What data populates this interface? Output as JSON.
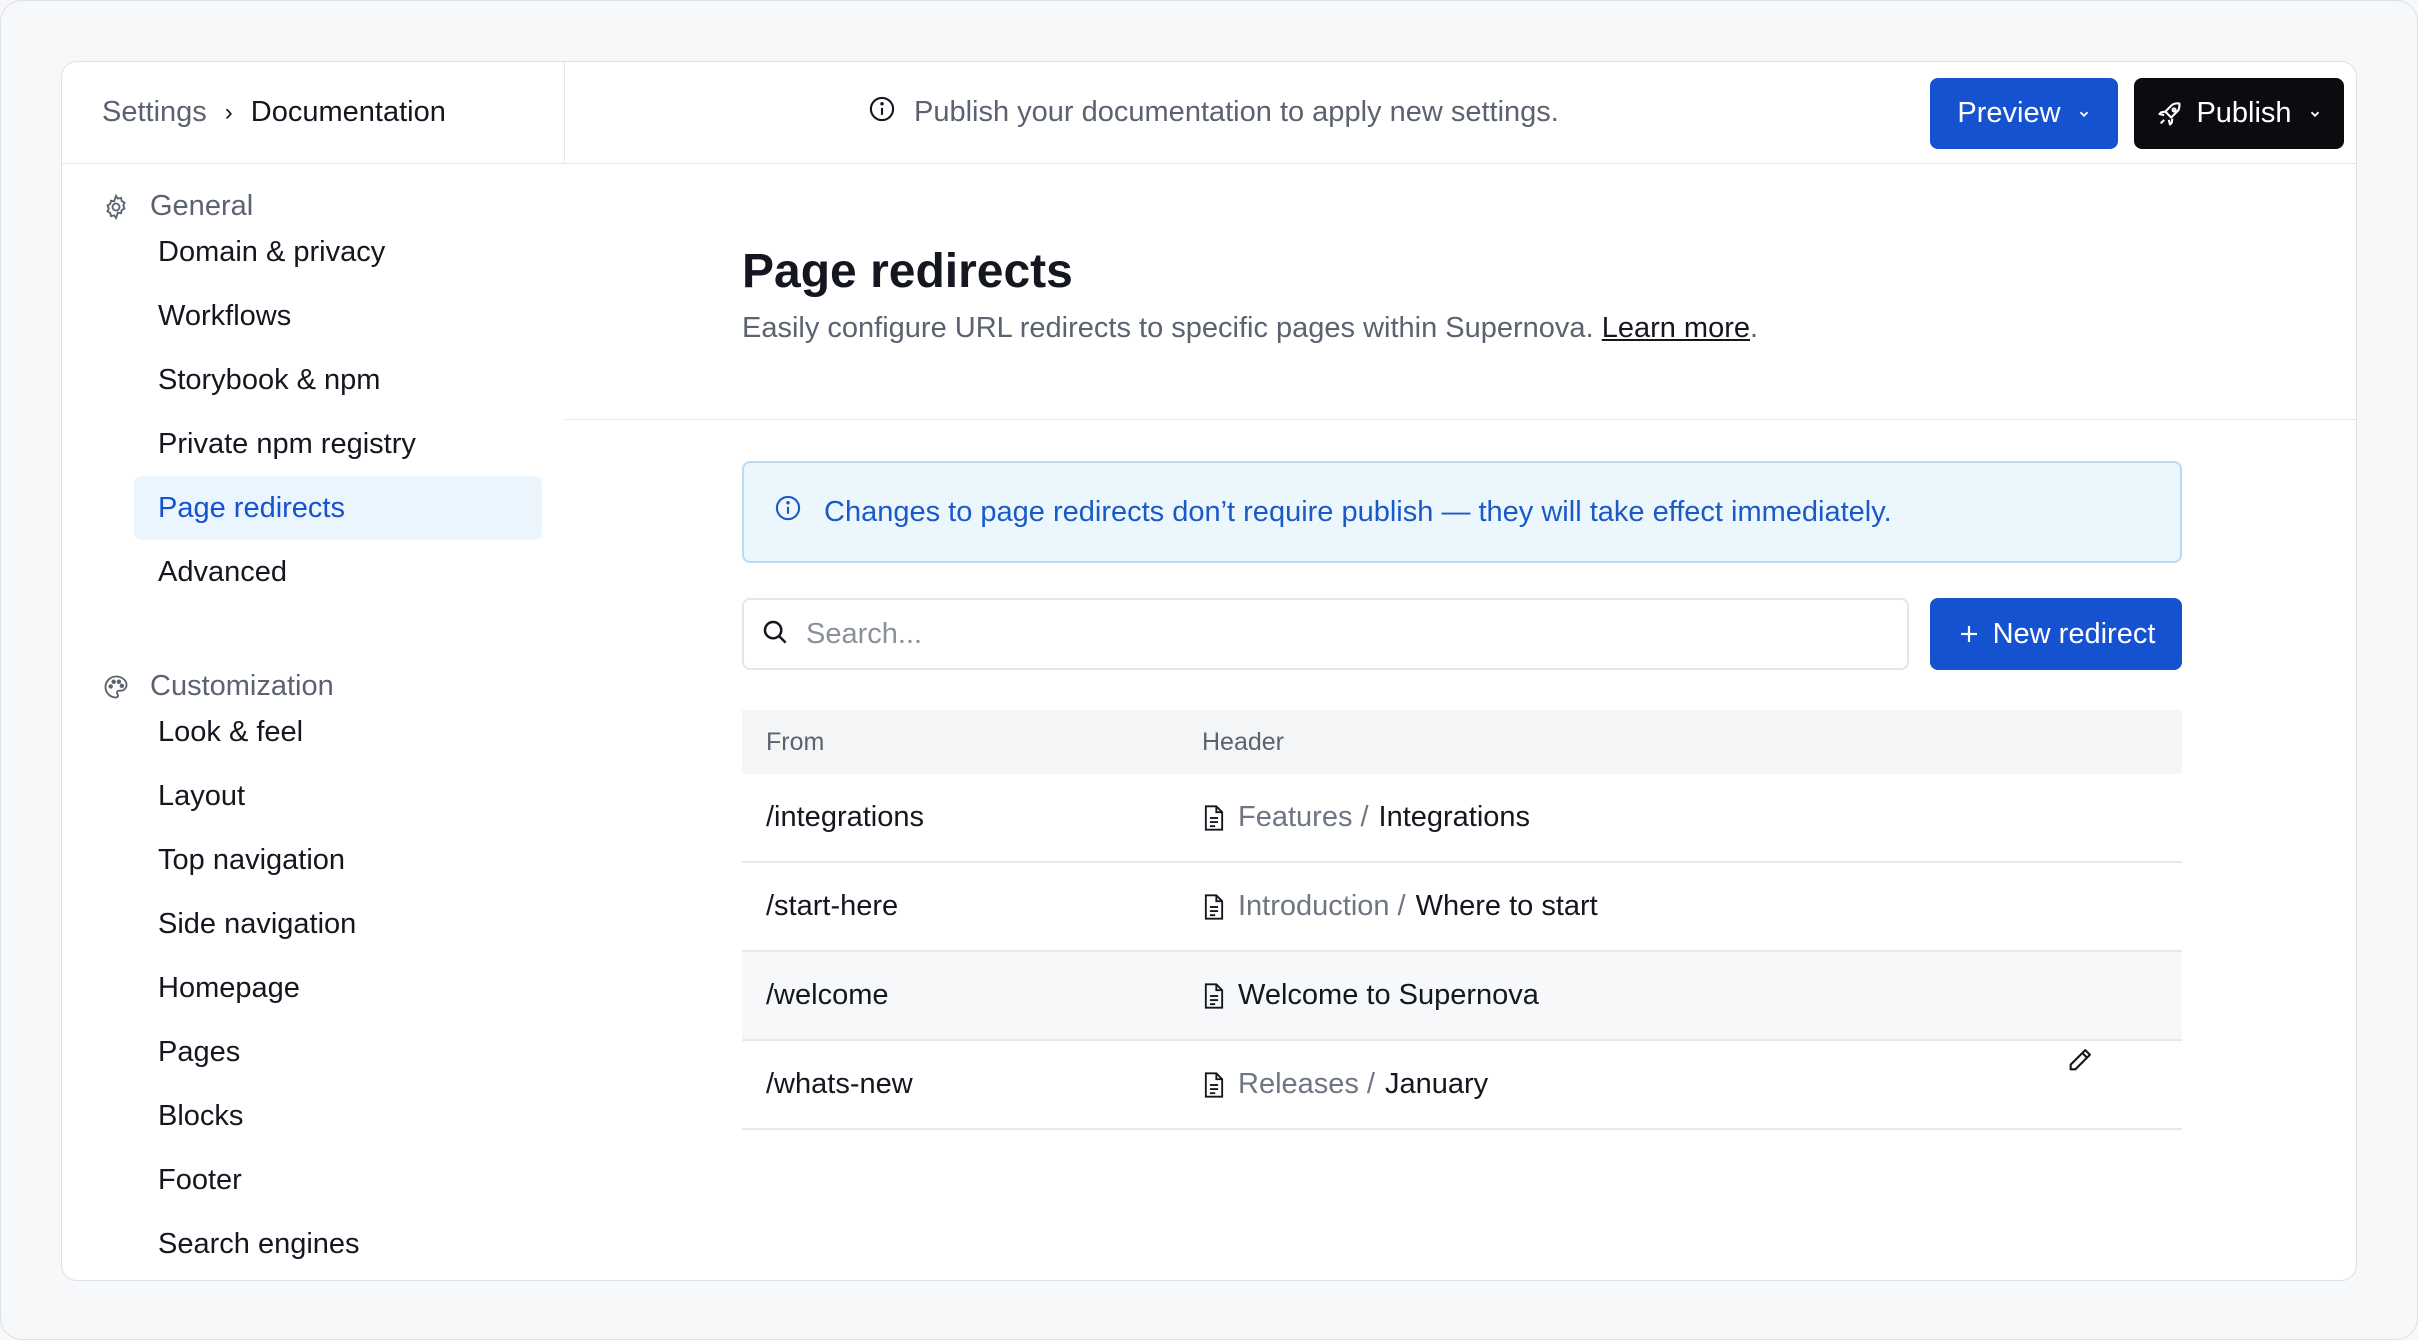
{
  "breadcrumb": {
    "root": "Settings",
    "current": "Documentation"
  },
  "topbar": {
    "notice": "Publish your documentation to apply new settings.",
    "preview_label": "Preview",
    "publish_label": "Publish"
  },
  "sidebar": {
    "groups": [
      {
        "label": "General",
        "icon": "gear-icon",
        "items": [
          "Domain & privacy",
          "Workflows",
          "Storybook & npm",
          "Private npm registry",
          "Page redirects",
          "Advanced"
        ]
      },
      {
        "label": "Customization",
        "icon": "palette-icon",
        "items": [
          "Look & feel",
          "Layout",
          "Top navigation",
          "Side navigation",
          "Homepage",
          "Pages",
          "Blocks",
          "Footer",
          "Search engines"
        ]
      }
    ],
    "active_item": "Page redirects"
  },
  "main": {
    "title": "Page redirects",
    "description": "Easily configure URL redirects to specific pages within Supernova. ",
    "learn_more": "Learn more",
    "description_end": ".",
    "banner": "Changes to page redirects don’t require publish — they will take effect immediately.",
    "search_placeholder": "Search...",
    "new_redirect_label": "New redirect",
    "table": {
      "columns": [
        "From",
        "Header"
      ],
      "rows": [
        {
          "from": "/integrations",
          "parent": "Features",
          "page": "Integrations"
        },
        {
          "from": "/start-here",
          "parent": "Introduction",
          "page": "Where to start"
        },
        {
          "from": "/welcome",
          "parent": "",
          "page": "Welcome to Supernova"
        },
        {
          "from": "/whats-new",
          "parent": "Releases",
          "page": "January"
        }
      ]
    }
  },
  "colors": {
    "accent": "#1552d0",
    "publish_bg": "#0b0c0f",
    "active_nav_bg": "#ebf5fd",
    "banner_bg": "#ecf6fd",
    "banner_text": "#1a5ac8"
  }
}
